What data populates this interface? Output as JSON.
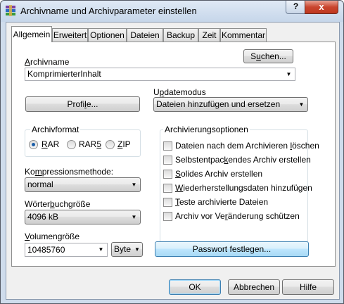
{
  "window": {
    "title": "Archivname und Archivparameter einstellen",
    "help_label": "?",
    "close_label": "x"
  },
  "tabs": [
    {
      "label": "Allgemein",
      "active": true
    },
    {
      "label": "Erweitert"
    },
    {
      "label": "Optionen"
    },
    {
      "label": "Dateien"
    },
    {
      "label": "Backup"
    },
    {
      "label": "Zeit"
    },
    {
      "label": "Kommentar"
    }
  ],
  "archive": {
    "name_label_pre": "",
    "name_label_u": "A",
    "name_label_post": "rchivname",
    "name_value": "KomprimierterInhalt",
    "search_pre": "S",
    "search_u": "u",
    "search_post": "chen...",
    "profile_pre": "Profi",
    "profile_u": "l",
    "profile_post": "e..."
  },
  "update": {
    "label_pre": "U",
    "label_u": "p",
    "label_post": "datemodus",
    "value": "Dateien hinzufügen und ersetzen"
  },
  "format": {
    "title": "Archivformat",
    "options": [
      {
        "pre": "",
        "u": "R",
        "post": "AR",
        "selected": true
      },
      {
        "pre": "RAR",
        "u": "5",
        "post": "",
        "selected": false
      },
      {
        "pre": "",
        "u": "Z",
        "post": "IP",
        "selected": false
      }
    ]
  },
  "compression": {
    "label_pre": "Ko",
    "label_u": "m",
    "label_post": "pressionsmethode:",
    "value": "normal"
  },
  "dictionary": {
    "label_pre": "Wörter",
    "label_u": "b",
    "label_post": "uchgröße",
    "value": "4096 kB"
  },
  "volume": {
    "label_pre": "",
    "label_u": "V",
    "label_post": "olumengröße",
    "value": "10485760",
    "unit": "Byte"
  },
  "options_group": {
    "title": "Archivierungsoptionen",
    "items": [
      {
        "pre": "Dateien nach dem Archivieren ",
        "u": "l",
        "post": "öschen"
      },
      {
        "pre": "Selbstentpac",
        "u": "k",
        "post": "endes Archiv erstellen"
      },
      {
        "pre": "",
        "u": "S",
        "post": "olides Archiv erstellen"
      },
      {
        "pre": "",
        "u": "W",
        "post": "iederherstellungsdaten hinzufügen"
      },
      {
        "pre": "",
        "u": "T",
        "post": "este archivierte Dateien"
      },
      {
        "pre": "Archiv vor Ve",
        "u": "r",
        "post": "änderung schützen"
      }
    ]
  },
  "password_button": "Passwort festlegen...",
  "footer": {
    "ok": "OK",
    "cancel": "Abbrechen",
    "help": "Hilfe"
  }
}
